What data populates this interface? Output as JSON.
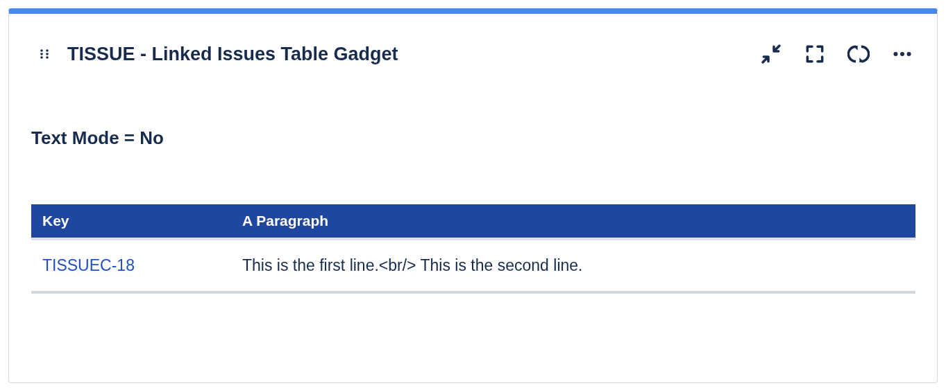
{
  "gadget": {
    "title": "TISSUE - Linked Issues Table Gadget"
  },
  "content": {
    "heading": "Text Mode = No"
  },
  "table": {
    "columns": [
      "Key",
      "A Paragraph"
    ],
    "rows": [
      {
        "key": "TISSUEC-18",
        "paragraph": "This is the first line.<br/> This is the second line."
      }
    ]
  }
}
